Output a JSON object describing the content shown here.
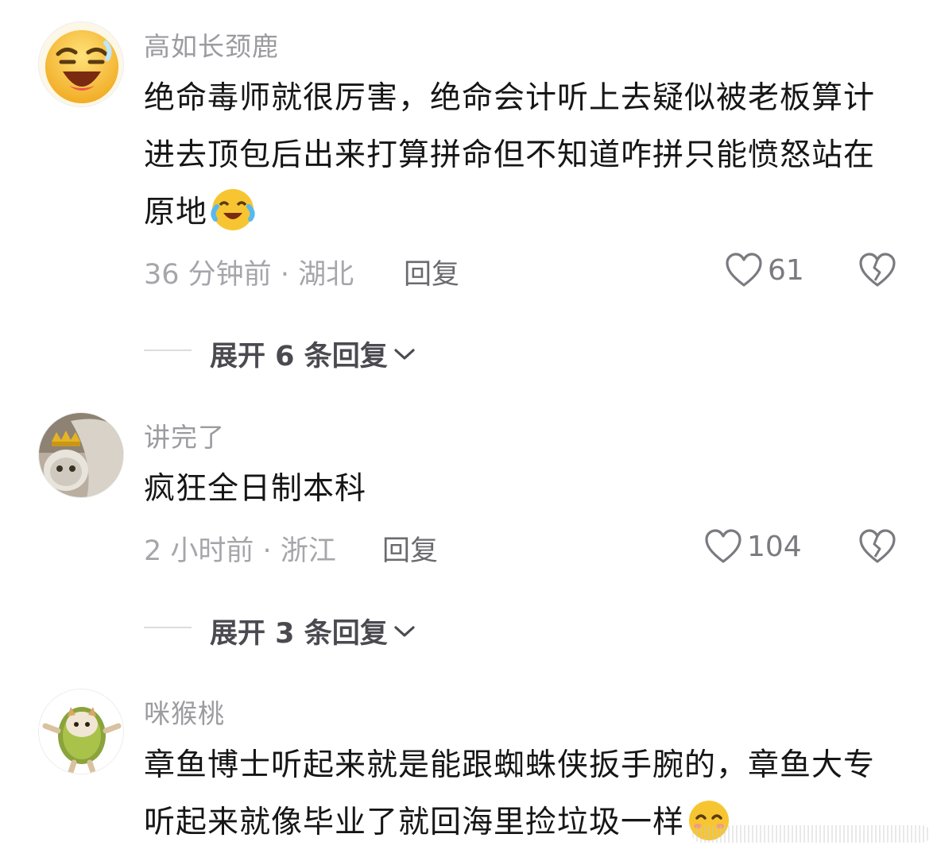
{
  "comments": [
    {
      "username": "高如长颈鹿",
      "text": "绝命毒师就很厉害，绝命会计听上去疑似被老板算计进去顶包后出来打算拼命但不知道咋拼只能愤怒站在原地",
      "time": "36 分钟前",
      "separator": "·",
      "location": "湖北",
      "reply_label": "回复",
      "likes": "61",
      "expand_label": "展开 6 条回复",
      "avatar_icon": "laughing-emoji-avatar",
      "inline_emoji": "crying-laughing-emoji"
    },
    {
      "username": "讲完了",
      "text": "疯狂全日制本科",
      "time": "2 小时前",
      "separator": "·",
      "location": "浙江",
      "reply_label": "回复",
      "likes": "104",
      "expand_label": "展开 3 条回复",
      "avatar_icon": "cat-with-crown-avatar"
    },
    {
      "username": "咪猴桃",
      "text": "章鱼博士听起来就是能跟蜘蛛侠扳手腕的，章鱼大专听起来就像毕业了就回海里捡垃圾一样",
      "avatar_icon": "kiwi-cat-avatar",
      "inline_emoji": "smiling-emoji"
    }
  ],
  "colors": {
    "text": "#161616",
    "muted": "#9b9ba0",
    "reply": "#6a6a6f",
    "emoji_yellow": "#f7c531"
  }
}
